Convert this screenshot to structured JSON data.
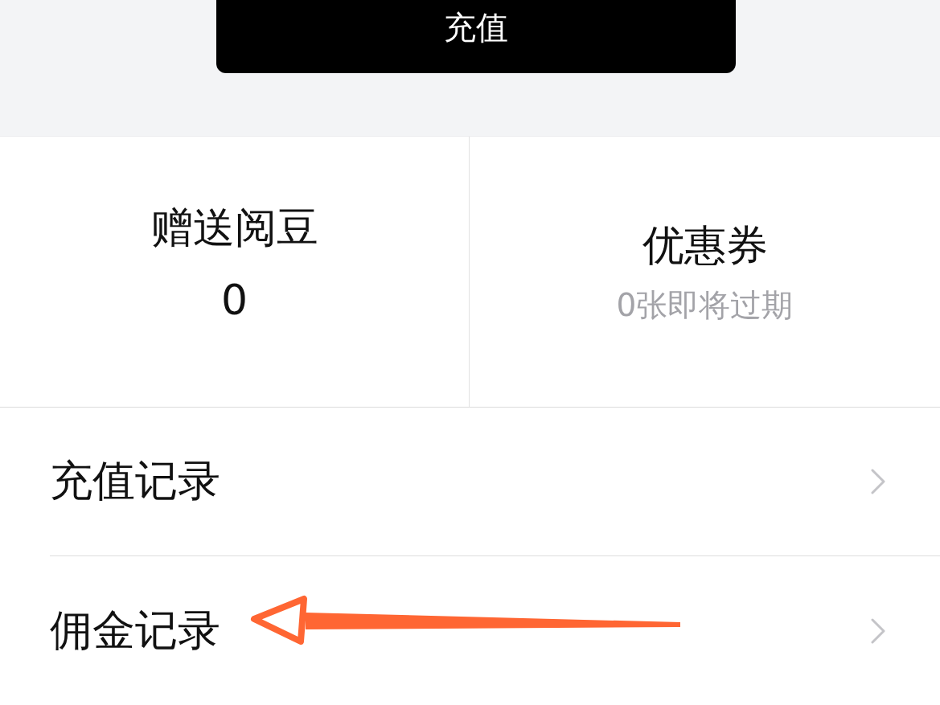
{
  "recharge_button": {
    "label": "充值"
  },
  "stats": [
    {
      "kind": "value",
      "label": "赠送阅豆",
      "value": "0"
    },
    {
      "kind": "note",
      "label": "优惠券",
      "note": "0张即将过期"
    }
  ],
  "menu": [
    {
      "label": "充值记录"
    },
    {
      "label": "佣金记录"
    }
  ]
}
